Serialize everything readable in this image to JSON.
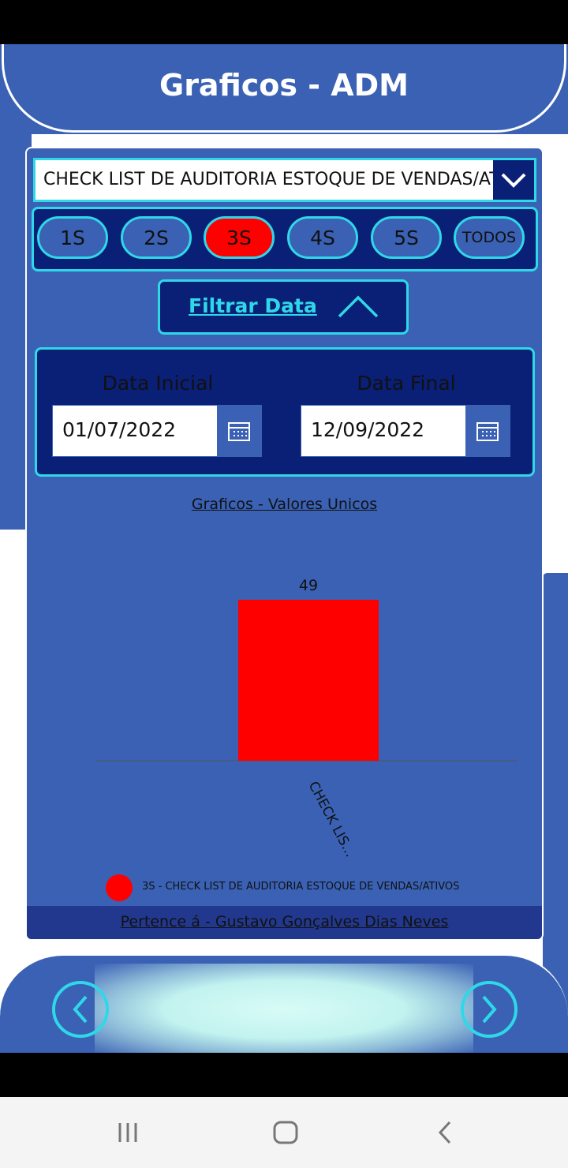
{
  "header": {
    "title": "Graficos - ADM"
  },
  "checklist_select": {
    "value": "CHECK LIST DE AUDITORIA ESTOQUE DE VENDAS/ATIVOS",
    "icon": "chevron-down-icon"
  },
  "segments": {
    "items": [
      "1S",
      "2S",
      "3S",
      "4S",
      "5S",
      "TODOS"
    ],
    "selected": "3S"
  },
  "filter": {
    "label": "Filtrar Data",
    "icon": "chevron-up-icon"
  },
  "dates": {
    "start_label": "Data Inicial",
    "start_value": "01/07/2022",
    "end_label": "Data Final",
    "end_value": "12/09/2022"
  },
  "chart_title": "Graficos - Valores Unicos",
  "chart_data": {
    "type": "bar",
    "categories": [
      "CHECK LIS..."
    ],
    "values": [
      49
    ],
    "series": [
      {
        "name": "3S - CHECK LIST DE AUDITORIA ESTOQUE DE VENDAS/ATIVOS",
        "values": [
          49
        ],
        "color": "#ff0000"
      }
    ],
    "ylim": [
      0,
      49
    ],
    "grid": false,
    "legend": "bottom"
  },
  "legend": {
    "label": "3S - CHECK LIST DE AUDITORIA ESTOQUE DE VENDAS/ATIVOS"
  },
  "footer": {
    "text": "Pertence á - Gustavo Gonçalves Dias Neves"
  },
  "colors": {
    "primary": "#3a61b4",
    "dark": "#0a1f76",
    "accent": "#2fd8e8",
    "selected": "#ff0000"
  }
}
